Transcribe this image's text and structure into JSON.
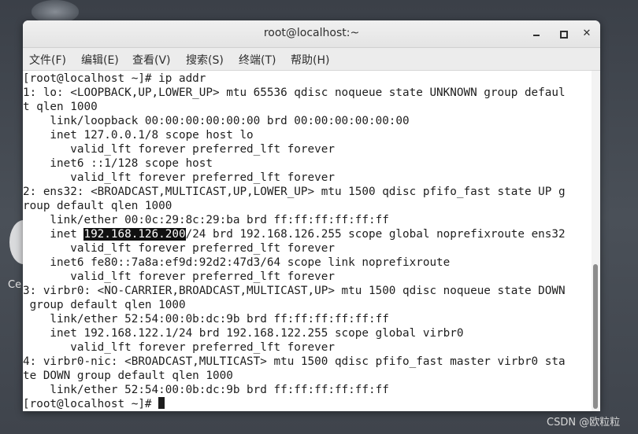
{
  "window": {
    "title": "root@localhost:~"
  },
  "menu": [
    {
      "label": "文件(F)"
    },
    {
      "label": "编辑(E)"
    },
    {
      "label": "查看(V)"
    },
    {
      "label": "搜索(S)"
    },
    {
      "label": "终端(T)"
    },
    {
      "label": "帮助(H)"
    }
  ],
  "desktop": {
    "icon_label": "Ce"
  },
  "watermark": "CSDN @欧粒粒",
  "terminal": {
    "lines": [
      "[root@localhost ~]# ip addr",
      "1: lo: <LOOPBACK,UP,LOWER_UP> mtu 65536 qdisc noqueue state UNKNOWN group defaul",
      "t qlen 1000",
      "    link/loopback 00:00:00:00:00:00 brd 00:00:00:00:00:00",
      "    inet 127.0.0.1/8 scope host lo",
      "       valid_lft forever preferred_lft forever",
      "    inet6 ::1/128 scope host",
      "       valid_lft forever preferred_lft forever",
      "2: ens32: <BROADCAST,MULTICAST,UP,LOWER_UP> mtu 1500 qdisc pfifo_fast state UP g",
      "roup default qlen 1000",
      "    link/ether 00:0c:29:8c:29:ba brd ff:ff:ff:ff:ff:ff",
      {
        "pre": "    inet ",
        "highlight": "192.168.126.200",
        "post": "/24 brd 192.168.126.255 scope global noprefixroute ens32"
      },
      "       valid_lft forever preferred_lft forever",
      "    inet6 fe80::7a8a:ef9d:92d2:47d3/64 scope link noprefixroute",
      "       valid_lft forever preferred_lft forever",
      "3: virbr0: <NO-CARRIER,BROADCAST,MULTICAST,UP> mtu 1500 qdisc noqueue state DOWN",
      " group default qlen 1000",
      "    link/ether 52:54:00:0b:dc:9b brd ff:ff:ff:ff:ff:ff",
      "    inet 192.168.122.1/24 brd 192.168.122.255 scope global virbr0",
      "       valid_lft forever preferred_lft forever",
      "4: virbr0-nic: <BROADCAST,MULTICAST> mtu 1500 qdisc pfifo_fast master virbr0 sta",
      "te DOWN group default qlen 1000",
      "    link/ether 52:54:00:0b:dc:9b brd ff:ff:ff:ff:ff:ff",
      "[root@localhost ~]# "
    ]
  }
}
